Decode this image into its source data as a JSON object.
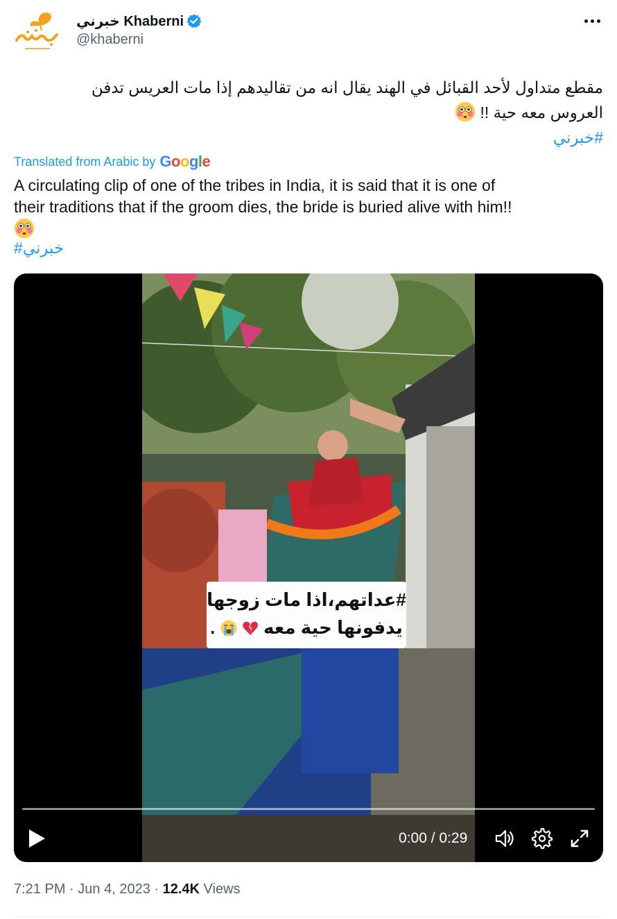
{
  "author": {
    "display_name": "خبرني Khaberni",
    "handle": "@khaberni",
    "verified": true,
    "avatar_icon": "khaberni-logo-icon"
  },
  "tweet": {
    "text_arabic_line1": "مقطع متداول لأحد القبائل في الهند يقال انه من تقاليدهم إذا مات العريس تدفن",
    "text_arabic_line2": "العروس معه حية !!",
    "hashtag": "#خبرني",
    "translated_label": "Translated from Arabic by",
    "translator": "Google",
    "text_english_line1": "A circulating clip of one of the tribes in India, it is said that it is one of",
    "text_english_line2": "their traditions that if the groom dies, the bride is buried alive with him!!",
    "emoji": "flushed-face-emoji"
  },
  "video": {
    "caption_line1": "#عداتهم،اذا مات زوجها",
    "caption_line2": "يدفونها حية معه",
    "caption_line2_end": ".",
    "time": "0:00 / 0:29",
    "progress": 0
  },
  "meta": {
    "time": "7:21 PM",
    "date": "Jun 4, 2023",
    "views_count": "12.4K",
    "views_label": "Views",
    "separator": "·"
  },
  "colors": {
    "accent": "#1d9bf0",
    "text": "#0f1419",
    "muted": "#536471",
    "avatar_orange": "#f3a21d"
  }
}
